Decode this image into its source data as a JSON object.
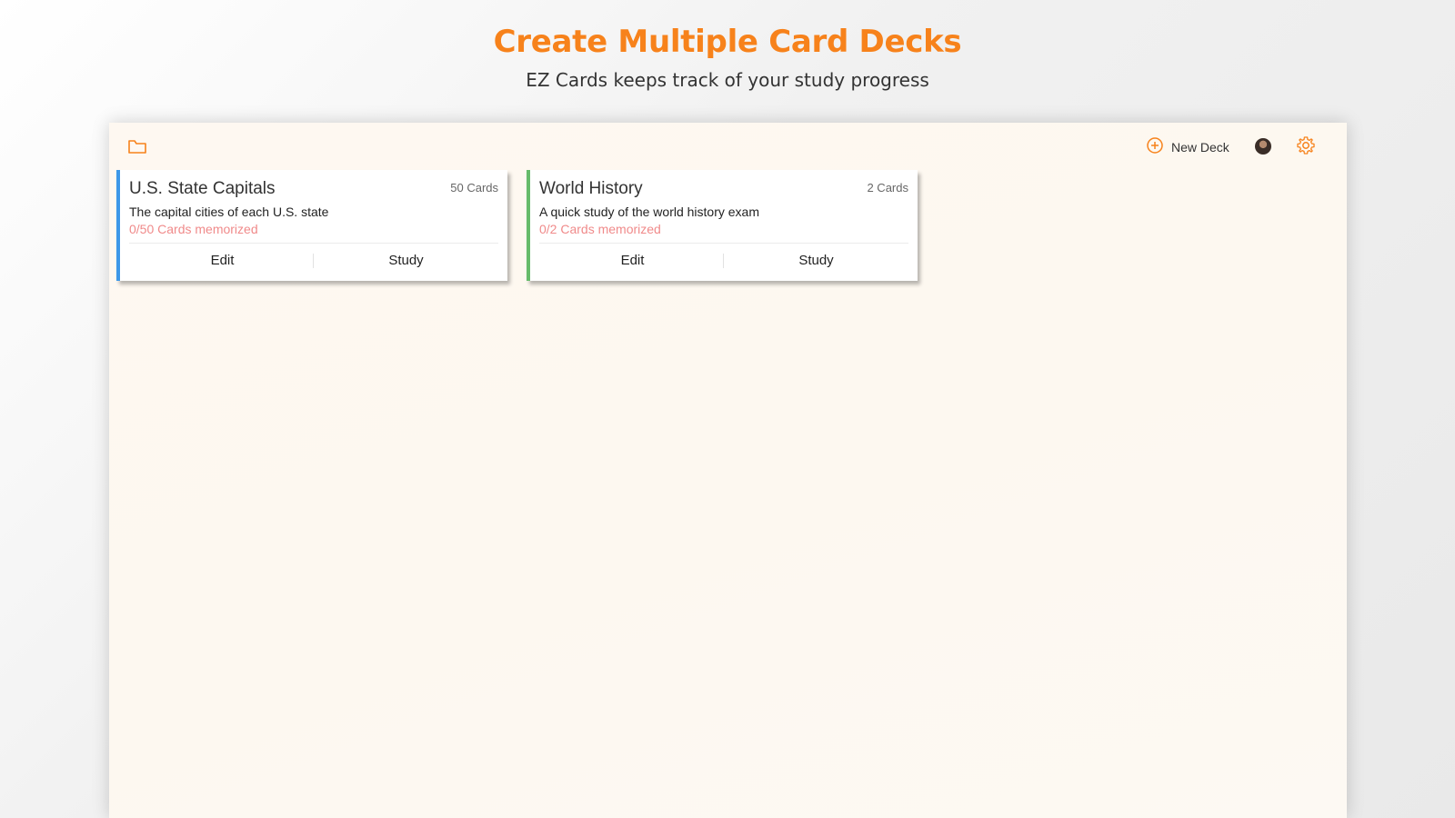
{
  "promo": {
    "title": "Create Multiple Card Decks",
    "subtitle": "EZ Cards keeps track of your study progress"
  },
  "toolbar": {
    "folder_icon": "folder-icon",
    "new_deck_icon": "plus-circle-icon",
    "new_deck_label": "New Deck",
    "settings_icon": "gear-icon",
    "accent_color": "#f7821b"
  },
  "decks": [
    {
      "title": "U.S. State Capitals",
      "count": "50 Cards",
      "description": "The capital cities of each U.S. state",
      "progress": "0/50 Cards memorized",
      "accent_color": "#3d98e8",
      "edit_label": "Edit",
      "study_label": "Study"
    },
    {
      "title": "World History",
      "count": "2 Cards",
      "description": "A quick study of the world history exam",
      "progress": "0/2 Cards memorized",
      "accent_color": "#66bb6a",
      "edit_label": "Edit",
      "study_label": "Study"
    }
  ]
}
